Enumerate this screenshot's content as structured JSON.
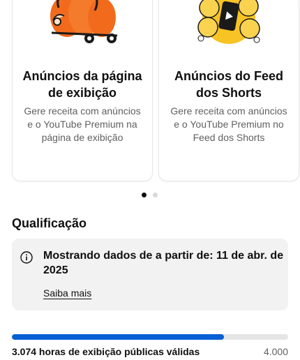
{
  "cards": [
    {
      "title": "Anúncios da página de exibição",
      "description": "Gere receita com anúncios e o YouTube Premium na página de exibição",
      "illustration": "orange-cart-icon"
    },
    {
      "title": "Anúncios do Feed dos Shorts",
      "description": "Gere receita com anúncios e o YouTube Premium no Feed dos Shorts",
      "illustration": "yellow-shorts-phone-icon"
    }
  ],
  "carousel": {
    "active_index": 0,
    "count": 2
  },
  "qualification": {
    "heading": "Qualificação",
    "notice_text": "Mostrando dados de a partir de: 11 de abr. de 2025",
    "learn_more": "Saiba mais"
  },
  "metric": {
    "label": "3.074 horas de exibição públicas válidas",
    "goal": "4.000",
    "progress_fraction": 0.7685
  },
  "colors": {
    "accent": "#065fd4",
    "orange": "#f26b1d",
    "yellow": "#f7c325"
  }
}
